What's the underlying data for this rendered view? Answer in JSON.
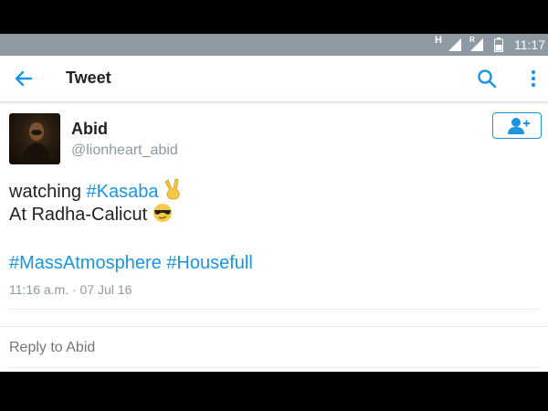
{
  "status_bar": {
    "network_type": "H",
    "roaming_indicator": "R",
    "time": "11:17"
  },
  "app_bar": {
    "title": "Tweet",
    "back_icon": "arrow-left-icon",
    "search_icon": "search-icon",
    "more_icon": "more-vertical-icon"
  },
  "tweet": {
    "author_name": "Abid",
    "author_handle": "@lionheart_abid",
    "follow_icon": "add-user-icon",
    "line1_prefix": "watching ",
    "line1_hashtag": "#Kasaba",
    "line1_emoji": "victory-hand-emoji",
    "line2_text": "At Radha-Calicut ",
    "line2_emoji": "sunglasses-face-emoji",
    "hashtag1": "#MassAtmosphere",
    "hashtag2": "#Housefull",
    "timestamp": "11:16 a.m. · 07 Jul 16"
  },
  "reply": {
    "placeholder": "Reply to Abid"
  },
  "colors": {
    "accent": "#1b95e0",
    "status_bar": "#8e9aa3",
    "secondary_text": "#8899a6"
  }
}
